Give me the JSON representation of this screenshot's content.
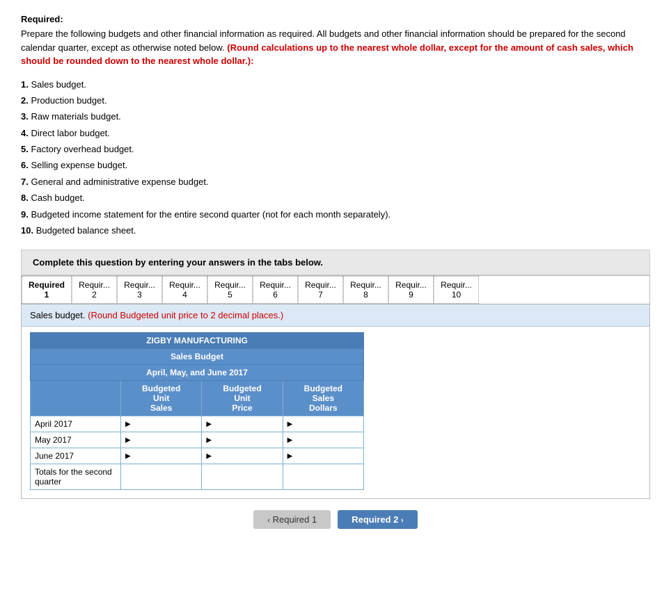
{
  "required_label": "Required:",
  "intro_text": "Prepare the following budgets and other financial information as required. All budgets and other financial information should be prepared for the second calendar quarter, except as otherwise noted below.",
  "red_instruction": "(Round calculations up to the nearest whole dollar, except for the amount of cash sales, which should be rounded down to the nearest whole dollar.):",
  "list_items": [
    {
      "number": "1",
      "text": "Sales budget."
    },
    {
      "number": "2",
      "text": "Production budget."
    },
    {
      "number": "3",
      "text": "Raw materials budget."
    },
    {
      "number": "4",
      "text": "Direct labor budget."
    },
    {
      "number": "5",
      "text": "Factory overhead budget."
    },
    {
      "number": "6",
      "text": "Selling expense budget."
    },
    {
      "number": "7",
      "text": "General and administrative expense budget."
    },
    {
      "number": "8",
      "text": "Cash budget."
    },
    {
      "number": "9",
      "text": "Budgeted income statement for the entire second quarter (not for each month separately)."
    },
    {
      "number": "10",
      "text": "Budgeted balance sheet."
    }
  ],
  "complete_question_text": "Complete this question by entering your answers in the tabs below.",
  "tabs": [
    {
      "label": "Required\n1",
      "active": true
    },
    {
      "label": "Requir...\n2"
    },
    {
      "label": "Requir...\n3"
    },
    {
      "label": "Requir...\n4"
    },
    {
      "label": "Requir...\n5"
    },
    {
      "label": "Requir...\n6"
    },
    {
      "label": "Requir...\n7"
    },
    {
      "label": "Requir...\n8"
    },
    {
      "label": "Requir...\n9"
    },
    {
      "label": "Requir...\n10"
    }
  ],
  "sales_note": "Sales budget.",
  "sales_note_red": "(Round Budgeted unit price to 2 decimal places.)",
  "table": {
    "title": "ZIGBY MANUFACTURING",
    "subtitle": "Sales Budget",
    "period": "April, May, and June 2017",
    "col_headers": [
      "Budgeted Unit Sales",
      "Budgeted Unit Price",
      "Budgeted Sales Dollars"
    ],
    "rows": [
      {
        "label": "April 2017"
      },
      {
        "label": "May 2017"
      },
      {
        "label": "June 2017"
      },
      {
        "label": "Totals for the second quarter"
      }
    ]
  },
  "nav": {
    "prev_label": "Required 1",
    "next_label": "Required 2"
  }
}
